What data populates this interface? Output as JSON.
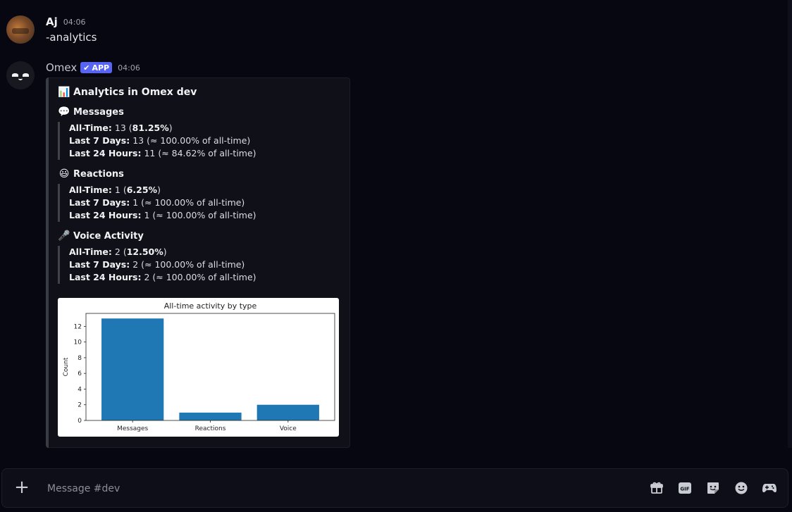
{
  "messages": [
    {
      "author": "Aj",
      "time": "04:06",
      "text": "-analytics"
    },
    {
      "author": "Omex",
      "badge": "APP",
      "time": "04:06",
      "embed": {
        "title_emoji": "📊",
        "title": "Analytics in Omex dev",
        "sections": [
          {
            "emoji": "💬",
            "title": "Messages",
            "lines": [
              {
                "label": "All-Time:",
                "value": "13 (",
                "bold": "81.25%",
                "suffix": ")"
              },
              {
                "label": "Last 7 Days:",
                "value": "13 (≈ 100.00% of all-time)"
              },
              {
                "label": "Last 24 Hours:",
                "value": "11 (≈ 84.62% of all-time)"
              }
            ]
          },
          {
            "emoji": "😃",
            "title": "Reactions",
            "lines": [
              {
                "label": "All-Time:",
                "value": "1 (",
                "bold": "6.25%",
                "suffix": ")"
              },
              {
                "label": "Last 7 Days:",
                "value": "1 (≈ 100.00% of all-time)"
              },
              {
                "label": "Last 24 Hours:",
                "value": "1 (≈ 100.00% of all-time)"
              }
            ]
          },
          {
            "emoji": "🎤",
            "title": "Voice Activity",
            "lines": [
              {
                "label": "All-Time:",
                "value": "2 (",
                "bold": "12.50%",
                "suffix": ")"
              },
              {
                "label": "Last 7 Days:",
                "value": "2 (≈ 100.00% of all-time)"
              },
              {
                "label": "Last 24 Hours:",
                "value": "2 (≈ 100.00% of all-time)"
              }
            ]
          }
        ]
      }
    }
  ],
  "chart_data": {
    "type": "bar",
    "title": "All-time activity by type",
    "categories": [
      "Messages",
      "Reactions",
      "Voice"
    ],
    "values": [
      13,
      1,
      2
    ],
    "xlabel": "",
    "ylabel": "Count",
    "ylim": [
      0,
      13.65
    ],
    "yticks": [
      0,
      2,
      4,
      6,
      8,
      10,
      12
    ],
    "bar_color": "#1f77b4",
    "grid": false
  },
  "composer": {
    "placeholder": "Message #dev"
  },
  "icons": [
    "plus-icon",
    "gift-icon",
    "gif-icon",
    "sticker-icon",
    "emoji-icon",
    "game-controller-icon"
  ],
  "colors": {
    "accent": "#5865f2",
    "background": "#070711",
    "embed_background": "#101019"
  }
}
